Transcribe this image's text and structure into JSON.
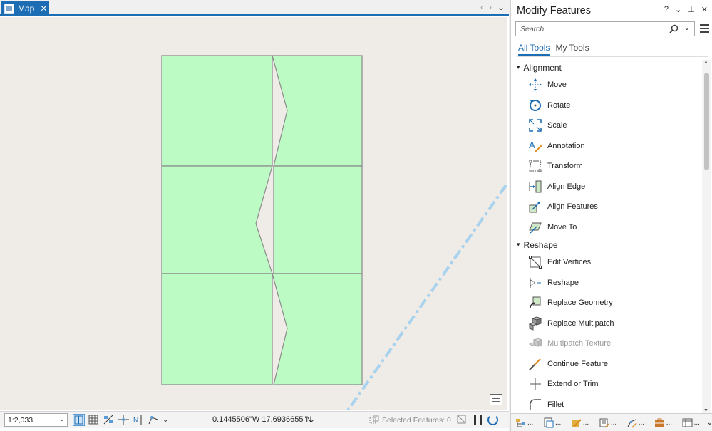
{
  "map_tab": {
    "label": "Map"
  },
  "map_nav": {
    "prev": "‹",
    "next": "›",
    "menu": "⌄"
  },
  "statusbar": {
    "scale": "1:2,033",
    "coords": "0.1445506\"W 17.6936655\"N",
    "selected_features": "Selected Features: 0"
  },
  "panel": {
    "title": "Modify Features",
    "controls": {
      "help": "?",
      "menu": "⌄",
      "pin": "⊥",
      "close": "✕"
    },
    "search_placeholder": "Search",
    "tabs": [
      "All Tools",
      "My Tools"
    ],
    "groups": [
      {
        "name": "Alignment",
        "tools": [
          {
            "label": "Move",
            "icon": "move-icon",
            "disabled": false
          },
          {
            "label": "Rotate",
            "icon": "rotate-icon",
            "disabled": false
          },
          {
            "label": "Scale",
            "icon": "scale-icon",
            "disabled": false
          },
          {
            "label": "Annotation",
            "icon": "annotation-icon",
            "disabled": false
          },
          {
            "label": "Transform",
            "icon": "transform-icon",
            "disabled": false
          },
          {
            "label": "Align Edge",
            "icon": "align-edge-icon",
            "disabled": false
          },
          {
            "label": "Align Features",
            "icon": "align-features-icon",
            "disabled": false
          },
          {
            "label": "Move To",
            "icon": "move-to-icon",
            "disabled": false
          }
        ]
      },
      {
        "name": "Reshape",
        "tools": [
          {
            "label": "Edit Vertices",
            "icon": "edit-vertices-icon",
            "disabled": false
          },
          {
            "label": "Reshape",
            "icon": "reshape-icon",
            "disabled": false
          },
          {
            "label": "Replace Geometry",
            "icon": "replace-geometry-icon",
            "disabled": false
          },
          {
            "label": "Replace Multipatch",
            "icon": "replace-multipatch-icon",
            "disabled": false
          },
          {
            "label": "Multipatch Texture",
            "icon": "multipatch-texture-icon",
            "disabled": true
          },
          {
            "label": "Continue Feature",
            "icon": "continue-feature-icon",
            "disabled": false
          },
          {
            "label": "Extend or Trim",
            "icon": "extend-trim-icon",
            "disabled": false
          },
          {
            "label": "Fillet",
            "icon": "fillet-icon",
            "disabled": false
          }
        ]
      }
    ],
    "bottom_tabs": [
      "...",
      "...",
      "...",
      "...",
      "...",
      "...",
      "..."
    ]
  },
  "colors": {
    "accent": "#1c6db4",
    "polygon_fill": "#bdfbc4",
    "polygon_stroke": "#8a8a8a",
    "map_background": "#efebe6",
    "dashed_line": "#a8d2ee"
  }
}
